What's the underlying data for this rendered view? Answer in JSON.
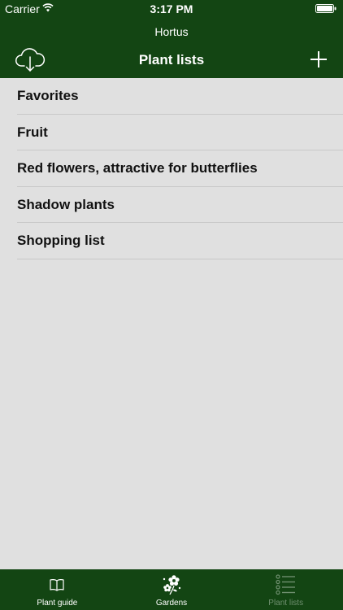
{
  "colors": {
    "header_bg": "#134513",
    "list_bg": "#e0e0e0",
    "text": "#111111",
    "tab_active": "#ffffff",
    "tab_inactive": "#6f8f6f"
  },
  "status_bar": {
    "carrier": "Carrier",
    "time": "3:17 PM"
  },
  "header": {
    "app_title": "Hortus",
    "nav_title": "Plant lists",
    "left_icon": "cloud-download-icon",
    "right_icon": "plus-icon"
  },
  "plant_lists": [
    {
      "label": "Favorites"
    },
    {
      "label": "Fruit"
    },
    {
      "label": "Red flowers, attractive for butterflies"
    },
    {
      "label": "Shadow plants"
    },
    {
      "label": "Shopping list"
    }
  ],
  "tabs": [
    {
      "label": "Plant guide",
      "icon": "book-icon"
    },
    {
      "label": "Gardens",
      "icon": "flowers-icon"
    },
    {
      "label": "Plant lists",
      "icon": "list-icon",
      "selected": true
    }
  ]
}
